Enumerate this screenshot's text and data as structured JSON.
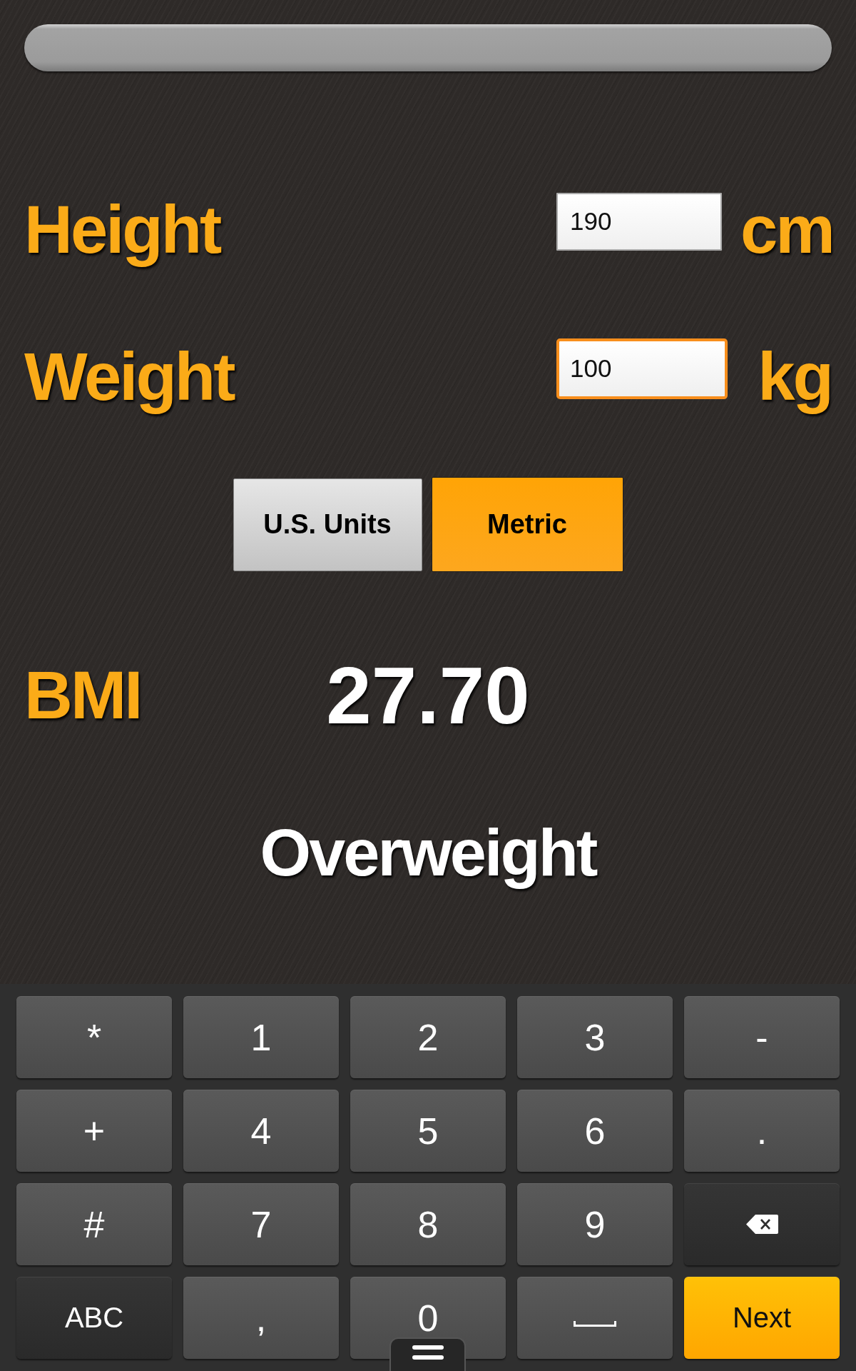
{
  "fields": [
    {
      "label": "Height",
      "value": "190",
      "unit": "cm",
      "focused": false
    },
    {
      "label": "Weight",
      "value": "100",
      "unit": "kg",
      "focused": true
    }
  ],
  "unit_toggle": [
    {
      "label": "U.S. Units",
      "selected": false
    },
    {
      "label": "Metric",
      "selected": true
    }
  ],
  "result": {
    "label": "BMI",
    "value": "27.70",
    "category": "Overweight"
  },
  "keyboard": {
    "rows": [
      [
        {
          "kind": "char",
          "label": "*"
        },
        {
          "kind": "char",
          "label": "1"
        },
        {
          "kind": "char",
          "label": "2"
        },
        {
          "kind": "char",
          "label": "3"
        },
        {
          "kind": "char",
          "label": "-"
        }
      ],
      [
        {
          "kind": "char",
          "label": "+"
        },
        {
          "kind": "char",
          "label": "4"
        },
        {
          "kind": "char",
          "label": "5"
        },
        {
          "kind": "char",
          "label": "6"
        },
        {
          "kind": "char",
          "label": "."
        }
      ],
      [
        {
          "kind": "char",
          "label": "#"
        },
        {
          "kind": "char",
          "label": "7"
        },
        {
          "kind": "char",
          "label": "8"
        },
        {
          "kind": "char",
          "label": "9"
        },
        {
          "kind": "backspace"
        }
      ],
      [
        {
          "kind": "mode",
          "label": "ABC"
        },
        {
          "kind": "char",
          "label": ","
        },
        {
          "kind": "char",
          "label": "0"
        },
        {
          "kind": "space"
        },
        {
          "kind": "action",
          "label": "Next"
        }
      ]
    ]
  }
}
